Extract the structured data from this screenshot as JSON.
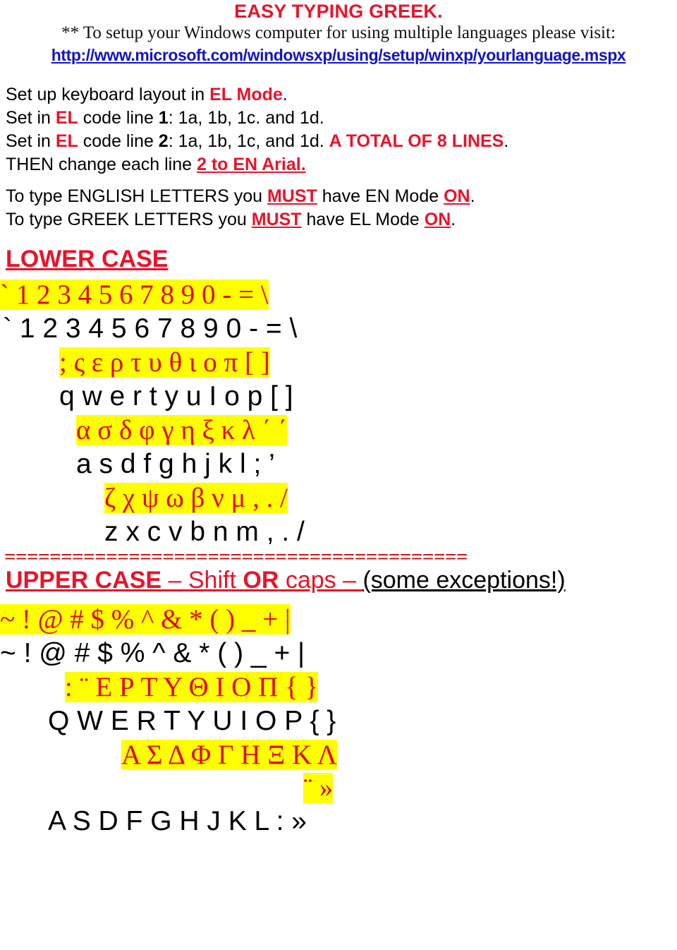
{
  "document": {
    "title": "EASY TYPING GREEK.",
    "note_prefix": "** To setup your Windows computer for using multiple languages please visit:",
    "url": "http://www.microsoft.com/windowsxp/using/setup/winxp/yourlanguage.mspx"
  },
  "instructions": [
    {
      "parts": [
        {
          "text": "Set up keyboard layout in ",
          "style": "black"
        },
        {
          "text": "EL Mode",
          "style": "red-bold"
        },
        {
          "text": ".",
          "style": "black"
        }
      ]
    },
    {
      "parts": [
        {
          "text": "Set in ",
          "style": "black"
        },
        {
          "text": "EL",
          "style": "red-bold"
        },
        {
          "text": " code line ",
          "style": "black"
        },
        {
          "text": "1",
          "style": "black-bold"
        },
        {
          "text": ": 1a, 1b, 1c. and 1d.",
          "style": "black"
        }
      ]
    },
    {
      "parts": [
        {
          "text": "Set in ",
          "style": "black"
        },
        {
          "text": "EL",
          "style": "red-bold"
        },
        {
          "text": " code line ",
          "style": "black"
        },
        {
          "text": "2",
          "style": "black-bold"
        },
        {
          "text": ": 1a, 1b, 1c, and 1d. ",
          "style": "black"
        },
        {
          "text": "A TOTAL OF 8 LINES",
          "style": "red-bold"
        },
        {
          "text": ".",
          "style": "black"
        }
      ]
    },
    {
      "parts": [
        {
          "text": "THEN change each line ",
          "style": "black"
        },
        {
          "text": "2 to EN Arial.",
          "style": "red-bold-underline"
        }
      ]
    }
  ],
  "mode_notes": [
    {
      "parts": [
        {
          "text": "To type ENGLISH LETTERS you ",
          "style": "black"
        },
        {
          "text": "MUST",
          "style": "red-bold-underline"
        },
        {
          "text": " have EN Mode ",
          "style": "black"
        },
        {
          "text": "ON",
          "style": "red-bold-underline"
        },
        {
          "text": ".",
          "style": "black"
        }
      ]
    },
    {
      "parts": [
        {
          "text": "To type GREEK LETTERS you ",
          "style": "black"
        },
        {
          "text": "MUST",
          "style": "red-bold-underline"
        },
        {
          "text": " have EL Mode ",
          "style": "black"
        },
        {
          "text": "ON",
          "style": "red-bold-underline"
        },
        {
          "text": ".",
          "style": "black"
        }
      ]
    }
  ],
  "lower_case": {
    "heading": "LOWER CASE",
    "rows": [
      {
        "greek": "`  1  2  3  4   5  6  7  8  9  0  -  =  \\",
        "english": "`  1  2  3  4   5  6  7  8  9  0  -  =  \\"
      },
      {
        "greek": ";  ς  ε  ρ  τ  υ  θ  ι  ο  π  [  ]",
        "english": "q  w  e  r  t  y  u  I  o  p  [  ]"
      },
      {
        "greek": "α  σ  δ  φ  γ  η  ξ  κ  λ  ΄  ΄",
        "english": "a  s  d  f  g  h  j  k l  ;  ’"
      },
      {
        "greek": "ζ  χ  ψ  ω  β  ν  μ  ,  .  /",
        "english": "z  x  c  v  b  n m  ,  .  /"
      }
    ]
  },
  "separator": "=========================================",
  "upper_case": {
    "heading_parts": [
      {
        "text": "UPPER CASE",
        "style": "red-bold-underline"
      },
      {
        "text": " – ",
        "style": "red-underline"
      },
      {
        "text": "Shift",
        "style": "red-underline"
      },
      {
        "text": " ",
        "style": "red-underline"
      },
      {
        "text": "OR",
        "style": "red-bold-underline"
      },
      {
        "text": " caps ",
        "style": "red-underline"
      },
      {
        "text": "– ",
        "style": "red-underline"
      },
      {
        "text": "(some exceptions!)",
        "style": "black-underline"
      }
    ],
    "rows": [
      {
        "greek": "~  !  @   #  $   %  ^  &  *  (  )  _  +  |",
        "english": "~  !  @  #  $   %  ^  &   *  (  )  _  +  |"
      },
      {
        "greek": ":    ¨   Ε  Ρ   Τ  Υ  Θ  Ι  Ο  Π  {  }",
        "english": "Q   W E  R   T  Y  U  I  O  P  {  }"
      },
      {
        "greek": "Α   Σ   Δ    Φ    Γ   Η   Ξ  Κ  Λ",
        "wrapped": "¨   »",
        "english": "A   S   D   F   G  H  J   K   L  :  »"
      }
    ]
  },
  "colors": {
    "red": "#e8142a",
    "greek_red": "#e20a14",
    "highlight": "#ffff00",
    "link_blue": "#1414c8",
    "separator_red": "#c51616",
    "black": "#000000"
  }
}
